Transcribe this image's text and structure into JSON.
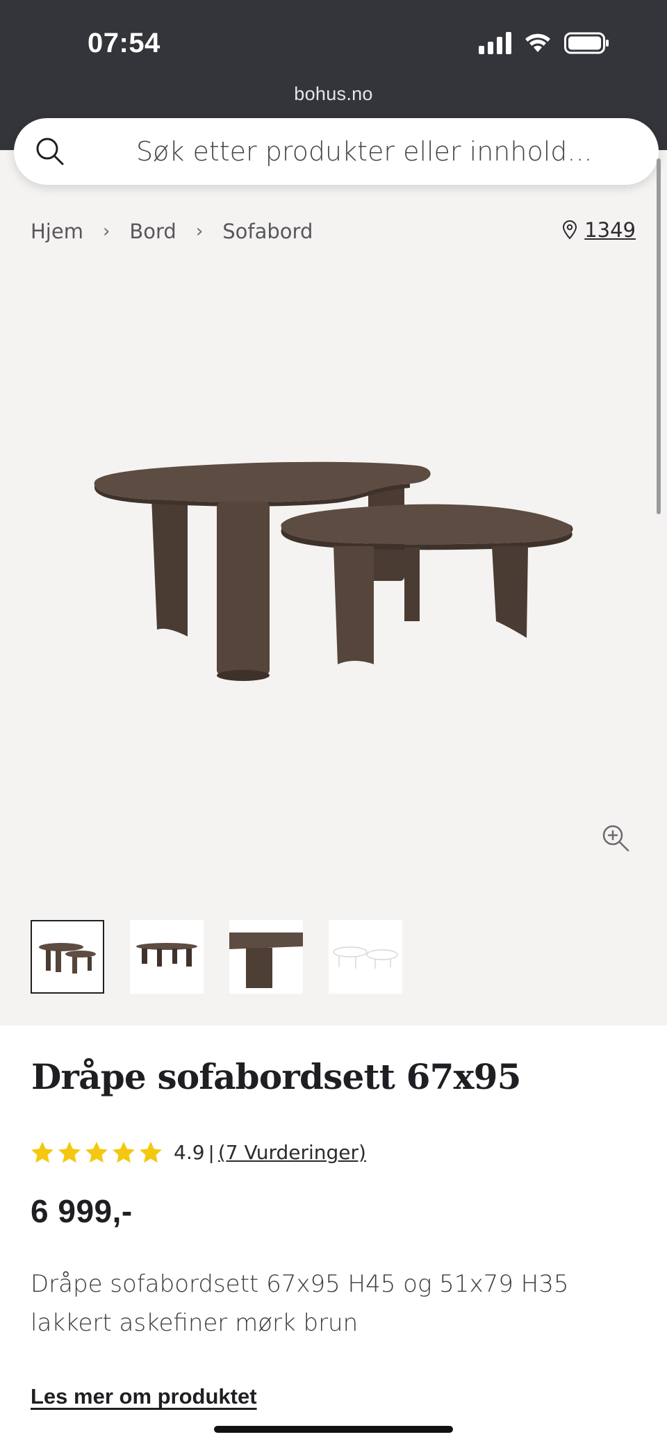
{
  "status_bar": {
    "time": "07:54"
  },
  "browser": {
    "url": "bohus.no"
  },
  "search": {
    "placeholder": "Søk etter produkter eller innhold..."
  },
  "breadcrumb": {
    "items": [
      "Hjem",
      "Bord",
      "Sofabord"
    ]
  },
  "store": {
    "number": "1349"
  },
  "product": {
    "title": "Dråpe sofabordsett 67x95",
    "rating": {
      "value": "4.9",
      "separator": "|",
      "count_text": "(7 Vurderinger)",
      "stars": 5
    },
    "price": "6 999,-",
    "description": "Dråpe sofabordsett 67x95 H45 og 51x79 H35 lakkert askefiner mørk brun",
    "read_more_label": "Les mer om produktet"
  },
  "colors": {
    "top_bar": "#34353a",
    "gallery_bg": "#f5f3f1",
    "star": "#f3c80f",
    "wood": "#5a4a40"
  }
}
